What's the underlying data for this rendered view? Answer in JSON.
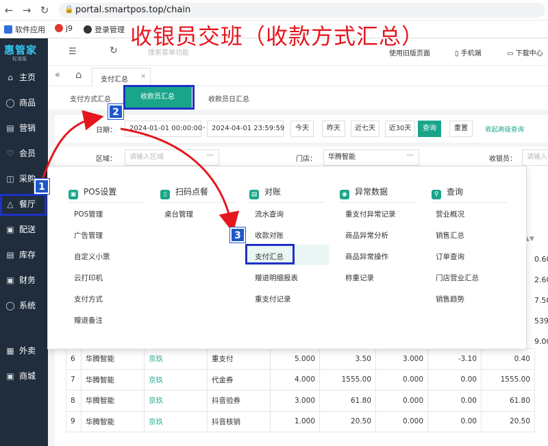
{
  "browser": {
    "url": "portal.smartpos.top/chain",
    "bookmarks": [
      {
        "label": "软件应用",
        "color": "#2f6fd8"
      },
      {
        "label": "j9",
        "color": "#e03a2f"
      },
      {
        "label": "登录管理",
        "color": "#333333"
      }
    ]
  },
  "overlay": {
    "title": "收银员交班（收款方式汇总）",
    "step1": "1",
    "step2": "2",
    "step3": "3"
  },
  "sidebar": {
    "logo": "惠管家",
    "logo_sub": "标准版",
    "items": [
      {
        "label": "主页",
        "icon": "home-icon"
      },
      {
        "label": "商品",
        "icon": "box-icon"
      },
      {
        "label": "营销",
        "icon": "chart-icon"
      },
      {
        "label": "会员",
        "icon": "heart-icon"
      },
      {
        "label": "采购",
        "icon": "cart-icon"
      },
      {
        "label": "餐厅",
        "icon": "bell-icon"
      },
      {
        "label": "配送",
        "icon": "truck-icon"
      },
      {
        "label": "库存",
        "icon": "stock-icon"
      },
      {
        "label": "财务",
        "icon": "finance-icon"
      },
      {
        "label": "系统",
        "icon": "gear-icon"
      },
      {
        "label": "外卖",
        "icon": "takeout-icon"
      },
      {
        "label": "商城",
        "icon": "shop-icon"
      }
    ]
  },
  "topbar": {
    "search_placeholder": "搜索菜单功能",
    "old_ui": "使用旧版页面",
    "mobile": "手机端",
    "download": "下载中心"
  },
  "tabs": {
    "active": "支付汇总"
  },
  "subtabs": {
    "pay_method": "支付方式汇总",
    "cashier": "收款员汇总",
    "cashier_daily": "收款员日汇总"
  },
  "filter": {
    "date_label": "日期：",
    "date_start": "2024-01-01 00:00:00",
    "date_sep": "-",
    "date_end": "2024-04-01 23:59:59",
    "btn_today": "今天",
    "btn_yesterday": "昨天",
    "btn_7days": "近七天",
    "btn_30days": "近30天",
    "btn_query": "查询",
    "btn_reset": "重置",
    "collapse": "收起高级查询",
    "area_label": "区域：",
    "area_placeholder": "请输入区域",
    "store_label": "门店：",
    "store_value": "华腾智能",
    "cashier_label": "收银员：",
    "cashier_placeholder": "请输入",
    "more": "···"
  },
  "menu": {
    "columns": [
      {
        "head": "POS设置",
        "items": [
          "POS管理",
          "广告管理",
          "自定义小票",
          "云打印机",
          "支付方式",
          "赠退备注"
        ]
      },
      {
        "head": "扫码点餐",
        "items": [
          "桌台管理"
        ]
      },
      {
        "head": "对账",
        "items": [
          "流水查询",
          "收款对账",
          "支付汇总",
          "赠退明细报表",
          "重支付记录"
        ]
      },
      {
        "head": "异常数据",
        "items": [
          "重支付异常记录",
          "商品异常分析",
          "商品异常操作",
          "称重记录"
        ]
      },
      {
        "head": "查询",
        "items": [
          "营业概况",
          "销售汇总",
          "订单查询",
          "门店营业汇总",
          "销售趋势"
        ]
      }
    ]
  },
  "table": {
    "partial_values": [
      "0.60",
      "2.60",
      "7.50",
      "539",
      "9.00"
    ],
    "rows": [
      {
        "no": "6",
        "store": "华腾智能",
        "cashier": "京玖",
        "method": "重支付",
        "count": "5.000",
        "amount": "3.50",
        "refund_count": "3.000",
        "refund": "-3.10",
        "net": "0.40"
      },
      {
        "no": "7",
        "store": "华腾智能",
        "cashier": "京玖",
        "method": "代金券",
        "count": "4.000",
        "amount": "1555.00",
        "refund_count": "0.000",
        "refund": "0.00",
        "net": "1555.00"
      },
      {
        "no": "8",
        "store": "华腾智能",
        "cashier": "京玖",
        "method": "抖音验券",
        "count": "3.000",
        "amount": "61.80",
        "refund_count": "0.000",
        "refund": "0.00",
        "net": "61.80"
      },
      {
        "no": "9",
        "store": "华腾智能",
        "cashier": "京玖",
        "method": "抖音核销",
        "count": "1.000",
        "amount": "20.50",
        "refund_count": "0.000",
        "refund": "0.00",
        "net": "20.50"
      }
    ]
  },
  "colors": {
    "accent": "#1aa58a",
    "sidebar": "#1f2d3d",
    "annotation_red": "#e4161e",
    "annotation_blue": "#1f30c8"
  }
}
